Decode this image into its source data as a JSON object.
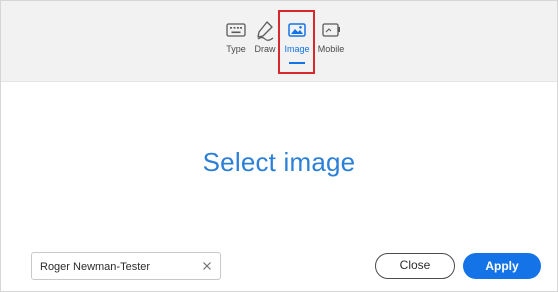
{
  "tabs": [
    {
      "label": "Type",
      "icon": "keyboard-icon",
      "active": false
    },
    {
      "label": "Draw",
      "icon": "pen-signature-icon",
      "active": false
    },
    {
      "label": "Image",
      "icon": "image-icon",
      "active": true
    },
    {
      "label": "Mobile",
      "icon": "mobile-icon",
      "active": false
    }
  ],
  "main": {
    "heading": "Select image"
  },
  "footer": {
    "name_value": "Roger Newman-Tester",
    "close_label": "Close",
    "apply_label": "Apply"
  },
  "colors": {
    "accent": "#1473e6",
    "heading": "#2c7fd7",
    "highlight": "#d9272e"
  }
}
